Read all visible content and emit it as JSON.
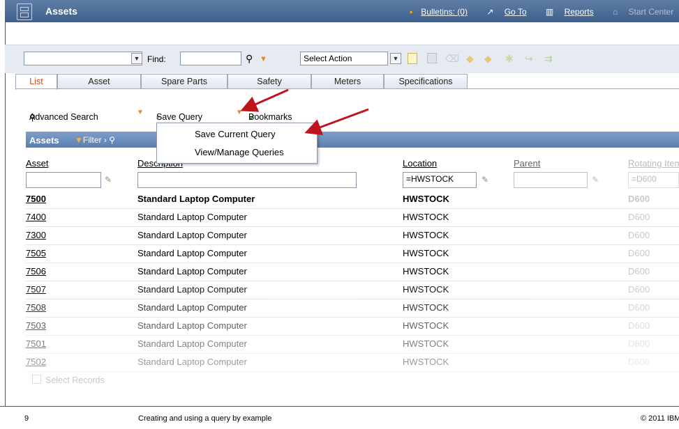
{
  "app": {
    "title": "Assets"
  },
  "top_links": {
    "bulletins": "Bulletins: (0)",
    "goto": "Go To",
    "reports": "Reports",
    "start_center": "Start Center"
  },
  "toolbar": {
    "find_label": "Find:",
    "find_value": "",
    "select_action": "Select Action"
  },
  "tabs": [
    "List",
    "Asset",
    "Spare Parts",
    "Safety",
    "Meters",
    "Specifications"
  ],
  "subbar": {
    "advanced_search": "Advanced Search",
    "save_query": "Save Query",
    "bookmarks": "Bookmarks"
  },
  "table": {
    "title": "Assets",
    "filter": "Filter"
  },
  "columns": {
    "asset": "Asset",
    "description": "Description",
    "location": "Location",
    "parent": "Parent",
    "rotating": "Rotating Item"
  },
  "filters": {
    "asset": "",
    "description": "",
    "location": "=HWSTOCK",
    "parent": "",
    "rotating": "=D600"
  },
  "rows": [
    {
      "asset": "7500",
      "description": "Standard Laptop Computer",
      "location": "HWSTOCK",
      "rotating": "D600"
    },
    {
      "asset": "7400",
      "description": "Standard Laptop Computer",
      "location": "HWSTOCK",
      "rotating": "D600"
    },
    {
      "asset": "7300",
      "description": "Standard Laptop Computer",
      "location": "HWSTOCK",
      "rotating": "D600"
    },
    {
      "asset": "7505",
      "description": "Standard Laptop Computer",
      "location": "HWSTOCK",
      "rotating": "D600"
    },
    {
      "asset": "7506",
      "description": "Standard Laptop Computer",
      "location": "HWSTOCK",
      "rotating": "D600"
    },
    {
      "asset": "7507",
      "description": "Standard Laptop Computer",
      "location": "HWSTOCK",
      "rotating": "D600"
    },
    {
      "asset": "7508",
      "description": "Standard Laptop Computer",
      "location": "HWSTOCK",
      "rotating": "D600"
    },
    {
      "asset": "7503",
      "description": "Standard Laptop Computer",
      "location": "HWSTOCK",
      "rotating": "D600"
    },
    {
      "asset": "7501",
      "description": "Standard Laptop Computer",
      "location": "HWSTOCK",
      "rotating": "D600"
    },
    {
      "asset": "7502",
      "description": "Standard Laptop Computer",
      "location": "HWSTOCK",
      "rotating": "D600"
    }
  ],
  "menu": {
    "save_current": "Save Current Query",
    "view_manage": "View/Manage Queries"
  },
  "select_records": "Select Records",
  "footer": {
    "page": "9",
    "caption": "Creating and using a query by example",
    "copyright": "© 2011 IBM"
  },
  "colors": {
    "title_bar": "#4a6a96",
    "active_tab": "#d64a1a",
    "arrow": "#c0141c"
  }
}
